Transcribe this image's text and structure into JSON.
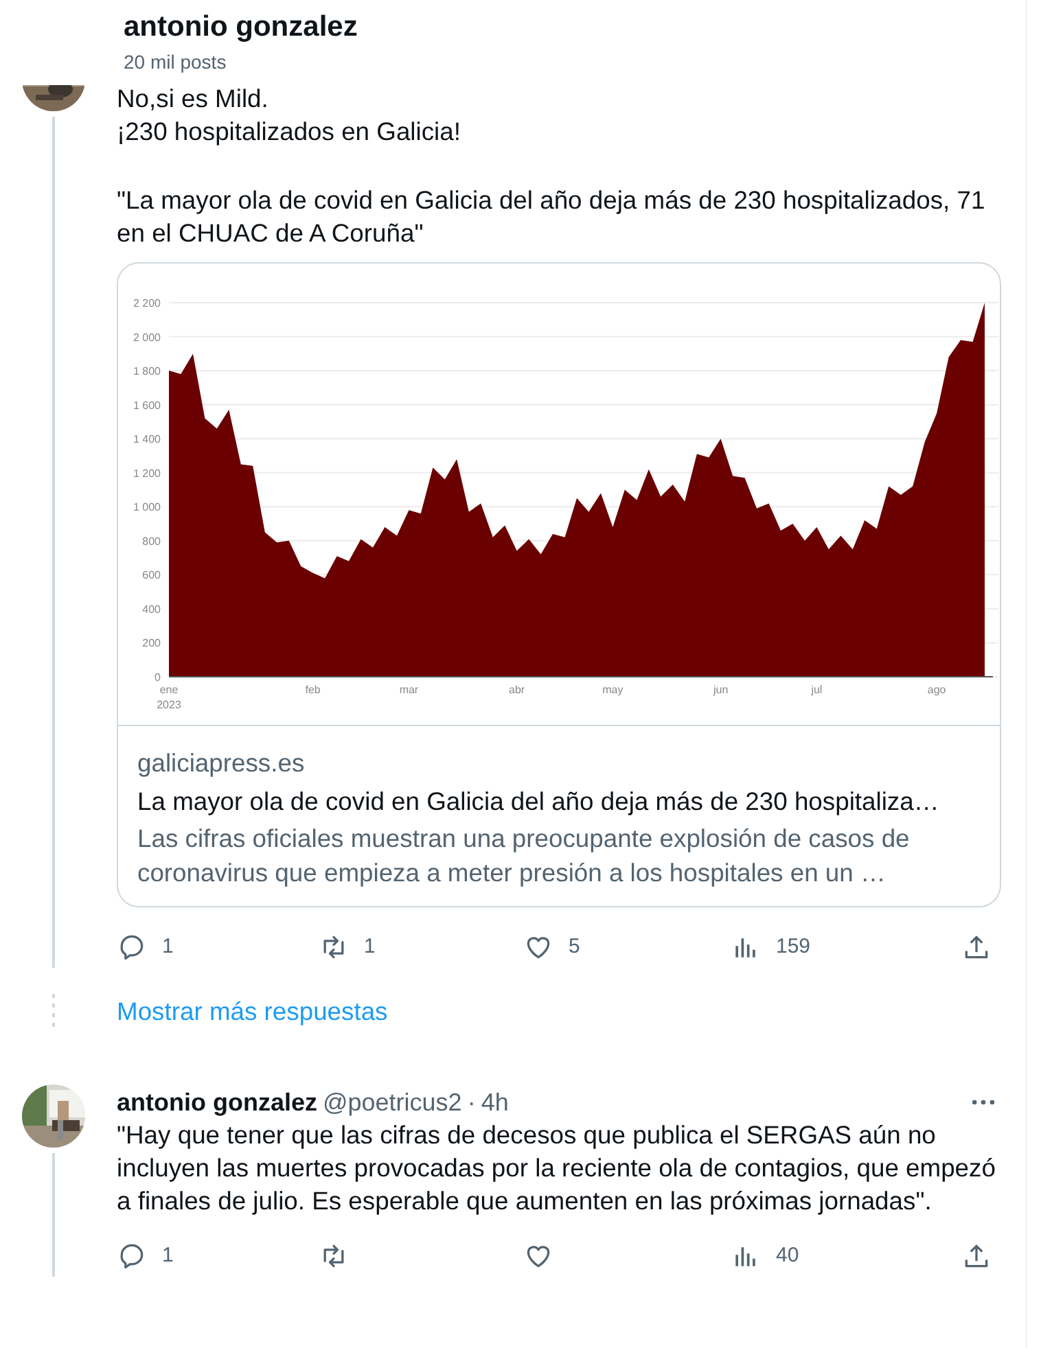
{
  "header": {
    "title": "antonio gonzalez",
    "subtitle": "20 mil posts"
  },
  "post": {
    "paragraphs": [
      "No,si es Mild.",
      "¡230 hospitalizados en Galicia!",
      "\"La mayor ola de covid en Galicia del año deja más de 230 hospitalizados, 71 en el CHUAC de A Coruña\""
    ],
    "link_card": {
      "chart_data": {
        "type": "area",
        "categories": [
          "ene 2023",
          null,
          null,
          null,
          null,
          null,
          null,
          null,
          null,
          null,
          null,
          null,
          "feb",
          null,
          null,
          null,
          null,
          null,
          null,
          null,
          "mar",
          null,
          null,
          null,
          null,
          null,
          null,
          null,
          null,
          "abr",
          null,
          null,
          null,
          null,
          null,
          null,
          null,
          "may",
          null,
          null,
          null,
          null,
          null,
          null,
          null,
          null,
          "jun",
          null,
          null,
          null,
          null,
          null,
          null,
          null,
          "jul",
          null,
          null,
          null,
          null,
          null,
          null,
          null,
          null,
          null,
          "ago",
          null,
          null,
          null,
          null
        ],
        "series": [
          {
            "color": "#6b0000",
            "values": [
              1800,
              1780,
              1900,
              1520,
              1460,
              1570,
              1250,
              1240,
              850,
              790,
              800,
              650,
              610,
              580,
              710,
              680,
              810,
              760,
              880,
              830,
              980,
              960,
              1230,
              1160,
              1280,
              970,
              1020,
              820,
              890,
              740,
              810,
              720,
              840,
              820,
              1050,
              970,
              1080,
              880,
              1100,
              1040,
              1220,
              1060,
              1130,
              1030,
              1310,
              1290,
              1400,
              1180,
              1170,
              990,
              1020,
              860,
              900,
              800,
              880,
              750,
              830,
              750,
              920,
              870,
              1120,
              1070,
              1120,
              1380,
              1550,
              1880,
              1980,
              1970,
              2200
            ]
          }
        ],
        "ylim": [
          0,
          2200
        ],
        "grid": true,
        "yticks": [
          {
            "value": 0,
            "label": "0"
          },
          {
            "value": 200,
            "label": "200"
          },
          {
            "value": 400,
            "label": "400"
          },
          {
            "value": 600,
            "label": "600"
          },
          {
            "value": 800,
            "label": "800"
          },
          {
            "value": 1000,
            "label": "1 000"
          },
          {
            "value": 1200,
            "label": "1 200"
          },
          {
            "value": 1400,
            "label": "1 400"
          },
          {
            "value": 1600,
            "label": "1 600"
          },
          {
            "value": 1800,
            "label": "1 800"
          },
          {
            "value": 2000,
            "label": "2 000"
          },
          {
            "value": 2200,
            "label": "2 200"
          }
        ]
      },
      "domain": "galiciapress.es",
      "title": "La mayor ola de covid en Galicia del año deja más de 230 hospitaliza…",
      "description": "Las cifras oficiales muestran una preocupante explosión de casos de coronavirus que empieza a meter presión a los hospitales en un …"
    },
    "actions": [
      {
        "kind": "reply",
        "count": "1"
      },
      {
        "kind": "repost",
        "count": "1"
      },
      {
        "kind": "like",
        "count": "5"
      },
      {
        "kind": "views",
        "count": "159"
      },
      {
        "kind": "share"
      }
    ]
  },
  "show_more": "Mostrar más respuestas",
  "reply": {
    "name": "antonio gonzalez",
    "handle": "@poetricus2",
    "separator": "·",
    "time": "4h",
    "text": "\"Hay que tener que las cifras de decesos que publica el SERGAS aún no incluyen las muertes provocadas por la reciente ola de contagios, que empezó a finales de julio. Es esperable que aumenten en las próximas jornadas\".",
    "actions": [
      {
        "kind": "reply",
        "count": "1"
      },
      {
        "kind": "repost"
      },
      {
        "kind": "like"
      },
      {
        "kind": "views",
        "count": "40"
      },
      {
        "kind": "share"
      }
    ]
  }
}
